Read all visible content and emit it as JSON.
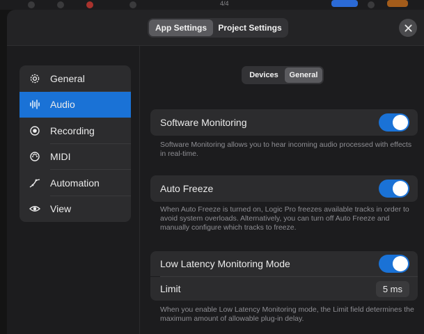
{
  "underlay": {
    "position_text": "4/4"
  },
  "header": {
    "tabs": [
      {
        "label": "App Settings",
        "active": true
      },
      {
        "label": "Project Settings",
        "active": false
      }
    ],
    "close_icon": "close-icon"
  },
  "sidebar": {
    "items": [
      {
        "label": "General",
        "icon": "gear-icon",
        "active": false
      },
      {
        "label": "Audio",
        "icon": "waveform-icon",
        "active": true
      },
      {
        "label": "Recording",
        "icon": "record-icon",
        "active": false
      },
      {
        "label": "MIDI",
        "icon": "midi-port-icon",
        "active": false
      },
      {
        "label": "Automation",
        "icon": "automation-curve-icon",
        "active": false
      },
      {
        "label": "View",
        "icon": "eye-icon",
        "active": false
      }
    ]
  },
  "subtabs": [
    {
      "label": "Devices",
      "active": false
    },
    {
      "label": "General",
      "active": true
    }
  ],
  "settings": {
    "software_monitoring": {
      "label": "Software Monitoring",
      "enabled": true,
      "description": "Software Monitoring allows you to hear incoming audio processed with effects in real-time."
    },
    "auto_freeze": {
      "label": "Auto Freeze",
      "enabled": true,
      "description": "When Auto Freeze is turned on, Logic Pro freezes available tracks in order to avoid system overloads. Alternatively, you can turn off Auto Freeze and manually configure which tracks to freeze."
    },
    "low_latency": {
      "label": "Low Latency Monitoring Mode",
      "enabled": true,
      "limit_label": "Limit",
      "limit_value": "5 ms",
      "description": "When you enable Low Latency Monitoring mode, the Limit field determines the maximum amount of allowable plug-in delay."
    }
  },
  "colors": {
    "accent": "#1a72d6",
    "background": "#1c1c1e",
    "row": "#2c2c2e",
    "secondary_text": "#8e8e93"
  }
}
